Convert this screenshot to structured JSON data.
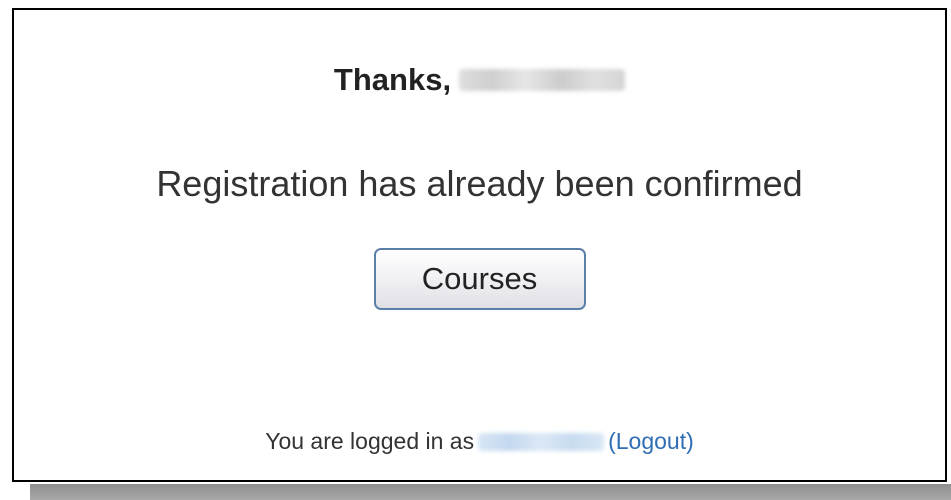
{
  "confirmation": {
    "thanks_text": "Thanks,",
    "message": "Registration has already been confirmed",
    "courses_button_label": "Courses"
  },
  "footer": {
    "logged_in_prefix": "You are logged in as",
    "logout_label": "(Logout)"
  },
  "colors": {
    "link": "#2f6eb5",
    "button_border": "#5c7fa8"
  }
}
